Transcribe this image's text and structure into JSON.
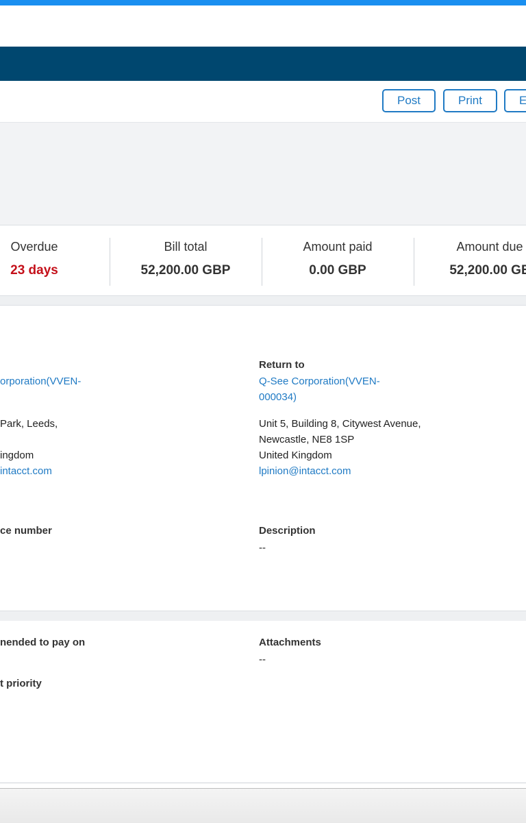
{
  "toolbar": {
    "post_label": "Post",
    "print_label": "Print",
    "edit_label": "E"
  },
  "summary": {
    "overdue_label": "Overdue",
    "overdue_value": "23 days",
    "bill_total_label": "Bill total",
    "bill_total_value": "52,200.00 GBP",
    "amount_paid_label": "Amount paid",
    "amount_paid_value": "0.00 GBP",
    "amount_due_label": "Amount due",
    "amount_due_value": "52,200.00 GE"
  },
  "vendor": {
    "name_line1": "orporation(VVEN-",
    "address_line1": "Park, Leeds,",
    "country": "ingdom",
    "email": "intacct.com",
    "reference_label": "ce number"
  },
  "return_to": {
    "label": "Return to",
    "name_line1": "Q-See Corporation(VVEN-",
    "name_line2": "000034)",
    "address_line1": "Unit 5, Building 8, Citywest Avenue,",
    "address_line2": "Newcastle, NE8 1SP",
    "country": "United Kingdom",
    "email": "lpinion@intacct.com"
  },
  "description": {
    "label": "Description",
    "value": "--"
  },
  "payment": {
    "recommended_label": "nended to pay on",
    "priority_label": "t priority"
  },
  "attachments": {
    "label": "Attachments",
    "value": "--"
  },
  "colors": {
    "accent": "#1a8ff0",
    "nav": "#00476f",
    "link": "#1f7ac4",
    "overdue": "#c4101a"
  }
}
